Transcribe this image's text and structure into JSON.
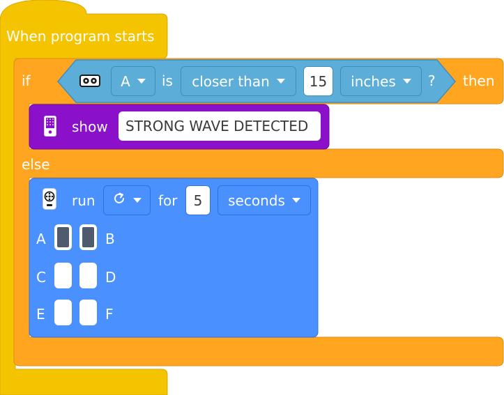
{
  "colors": {
    "event": "#F5C400",
    "control": "#FFA51F",
    "sensor": "#5DADD9",
    "display": "#8A10C9",
    "motor": "#4A90FF",
    "field_text": "#3A3A3A"
  },
  "hat": {
    "label": "When program starts"
  },
  "if_block": {
    "if_label": "if",
    "then_label": "then",
    "else_label": "else",
    "condition": {
      "sensor_icon": "distance-sensor-icon",
      "port": "A",
      "is_label": "is",
      "comparison": "closer than",
      "value": "15",
      "unit": "inches",
      "question_mark": "?"
    }
  },
  "show_block": {
    "icon": "light-matrix-icon",
    "label": "show",
    "text": "STRONG WAVE DETECTED"
  },
  "run_block": {
    "icon": "motor-icon",
    "label": "run",
    "direction_icon": "clockwise-icon",
    "for_label": "for",
    "value": "5",
    "unit": "seconds",
    "ports": [
      {
        "left": "A",
        "right": "B",
        "left_selected": true,
        "right_selected": true
      },
      {
        "left": "C",
        "right": "D",
        "left_selected": false,
        "right_selected": false
      },
      {
        "left": "E",
        "right": "F",
        "left_selected": false,
        "right_selected": false
      }
    ]
  }
}
